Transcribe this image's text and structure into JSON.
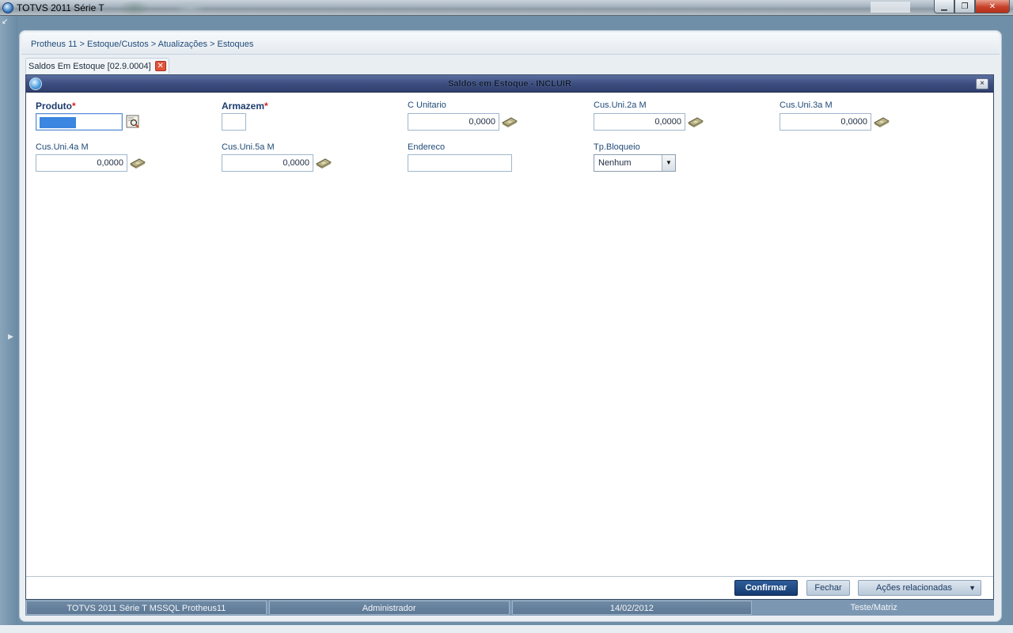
{
  "window": {
    "title": "TOTVS 2011 Série T",
    "controls": {
      "minimize": "▁",
      "maximize": "❐",
      "close": "✕"
    }
  },
  "breadcrumb": "Protheus 11 > Estoque/Custos > Atualizações > Estoques",
  "tab": {
    "label": "Saldos Em Estoque [02.9.0004]",
    "close": "✕"
  },
  "dialog": {
    "title": "Saldos em Estoque - INCLUIR",
    "close": "×"
  },
  "fields": {
    "produto": {
      "label": "Produto",
      "required_mark": "*",
      "value": ""
    },
    "armazem": {
      "label": "Armazem",
      "required_mark": "*",
      "value": ""
    },
    "c_unitario": {
      "label": "C Unitario",
      "value": "0,0000"
    },
    "cus_uni_2a": {
      "label": "Cus.Uni.2a M",
      "value": "0,0000"
    },
    "cus_uni_3a": {
      "label": "Cus.Uni.3a M",
      "value": "0,0000"
    },
    "cus_uni_4a": {
      "label": "Cus.Uni.4a M",
      "value": "0,0000"
    },
    "cus_uni_5a": {
      "label": "Cus.Uni.5a M",
      "value": "0,0000"
    },
    "endereco": {
      "label": "Endereco",
      "value": ""
    },
    "tp_bloqueio": {
      "label": "Tp.Bloqueio",
      "value": "Nenhum"
    }
  },
  "buttons": {
    "confirmar": "Confirmar",
    "fechar": "Fechar",
    "acoes": "Ações relacionadas"
  },
  "status": {
    "system": "TOTVS 2011 Série T  MSSQL Protheus11",
    "user": "Administrador",
    "date": "14/02/2012",
    "company": "Teste/Matriz"
  },
  "icons": {
    "lookup": "search-lookup-icon",
    "money": "money-calculator-icon"
  },
  "colors": {
    "dialog_header": "#3d4f80",
    "label": "#1f4a78",
    "required_star": "#d8231c",
    "primary_button": "#153b70"
  }
}
